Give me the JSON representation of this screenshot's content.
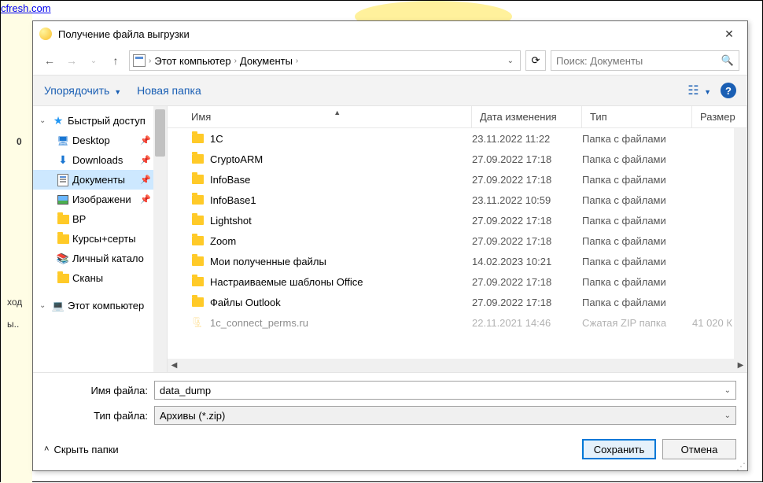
{
  "bg": {
    "link": "cfresh.com",
    "left1": "ход",
    "left2": "ы..",
    "left0": "0"
  },
  "title": "Получение файла выгрузки",
  "breadcrumb": {
    "b1": "Этот компьютер",
    "b2": "Документы"
  },
  "search_placeholder": "Поиск: Документы",
  "toolbar": {
    "org": "Упорядочить",
    "new": "Новая папка"
  },
  "tree": {
    "quick": "Быстрый доступ",
    "desktop": "Desktop",
    "downloads": "Downloads",
    "docs": "Документы",
    "images": "Изображени",
    "bp": "BP",
    "courses": "Курсы+серты",
    "catalog": "Личный катало",
    "scans": "Сканы",
    "pc": "Этот компьютер"
  },
  "cols": {
    "name": "Имя",
    "date": "Дата изменения",
    "type": "Тип",
    "size": "Размер"
  },
  "rows": [
    {
      "name": "1C",
      "date": "23.11.2022 11:22",
      "type": "Папка с файлами",
      "size": ""
    },
    {
      "name": "CryptoARM",
      "date": "27.09.2022 17:18",
      "type": "Папка с файлами",
      "size": ""
    },
    {
      "name": "InfoBase",
      "date": "27.09.2022 17:18",
      "type": "Папка с файлами",
      "size": ""
    },
    {
      "name": "InfoBase1",
      "date": "23.11.2022 10:59",
      "type": "Папка с файлами",
      "size": ""
    },
    {
      "name": "Lightshot",
      "date": "27.09.2022 17:18",
      "type": "Папка с файлами",
      "size": ""
    },
    {
      "name": "Zoom",
      "date": "27.09.2022 17:18",
      "type": "Папка с файлами",
      "size": ""
    },
    {
      "name": "Мои полученные файлы",
      "date": "14.02.2023 10:21",
      "type": "Папка с файлами",
      "size": ""
    },
    {
      "name": "Настраиваемые шаблоны Office",
      "date": "27.09.2022 17:18",
      "type": "Папка с файлами",
      "size": ""
    },
    {
      "name": "Файлы Outlook",
      "date": "27.09.2022 17:18",
      "type": "Папка с файлами",
      "size": ""
    },
    {
      "name": "1c_connect_perms.ru",
      "date": "22.11.2021 14:46",
      "type": "Сжатая ZIP папка",
      "size": "41 020 К"
    }
  ],
  "filename_label": "Имя файла:",
  "filename_value": "data_dump",
  "filetype_label": "Тип файла:",
  "filetype_value": "Архивы (*.zip)",
  "hide_folders": "Скрыть папки",
  "save": "Сохранить",
  "cancel": "Отмена"
}
